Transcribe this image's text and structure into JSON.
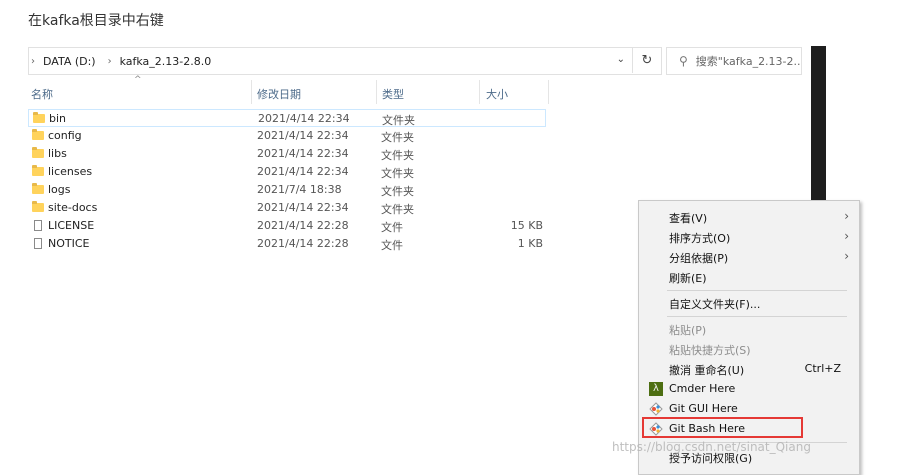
{
  "caption": "在kafka根目录中右键",
  "address": {
    "crumb1": "DATA (D:)",
    "crumb2": "kafka_2.13-2.8.0",
    "refresh_icon": "refresh-icon"
  },
  "search": {
    "placeholder": "搜索\"kafka_2.13-2..."
  },
  "columns": {
    "name": "名称",
    "date": "修改日期",
    "type": "类型",
    "size": "大小"
  },
  "files": [
    {
      "name": "bin",
      "date": "2021/4/14 22:34",
      "type": "文件夹",
      "size": "",
      "kind": "folder"
    },
    {
      "name": "config",
      "date": "2021/4/14 22:34",
      "type": "文件夹",
      "size": "",
      "kind": "folder"
    },
    {
      "name": "libs",
      "date": "2021/4/14 22:34",
      "type": "文件夹",
      "size": "",
      "kind": "folder"
    },
    {
      "name": "licenses",
      "date": "2021/4/14 22:34",
      "type": "文件夹",
      "size": "",
      "kind": "folder"
    },
    {
      "name": "logs",
      "date": "2021/7/4 18:38",
      "type": "文件夹",
      "size": "",
      "kind": "folder"
    },
    {
      "name": "site-docs",
      "date": "2021/4/14 22:34",
      "type": "文件夹",
      "size": "",
      "kind": "folder"
    },
    {
      "name": "LICENSE",
      "date": "2021/4/14 22:28",
      "type": "文件",
      "size": "15 KB",
      "kind": "file"
    },
    {
      "name": "NOTICE",
      "date": "2021/4/14 22:28",
      "type": "文件",
      "size": "1 KB",
      "kind": "file"
    }
  ],
  "context_menu": {
    "view": "查看(V)",
    "sort": "排序方式(O)",
    "group": "分组依据(P)",
    "refresh": "刷新(E)",
    "customize": "自定义文件夹(F)...",
    "paste": "粘贴(P)",
    "paste_shortcut": "粘贴快捷方式(S)",
    "undo_rename": "撤消 重命名(U)",
    "undo_shortcut": "Ctrl+Z",
    "cmder": "Cmder Here",
    "git_gui": "Git GUI Here",
    "git_bash": "Git Bash Here",
    "grant_access": "授予访问权限(G)"
  },
  "watermark": "https://blog.csdn.net/sinat_Qiang",
  "colors": {
    "highlight_border": "#e53935",
    "folder": "#ffd35c",
    "selection": "#cce8ff"
  }
}
